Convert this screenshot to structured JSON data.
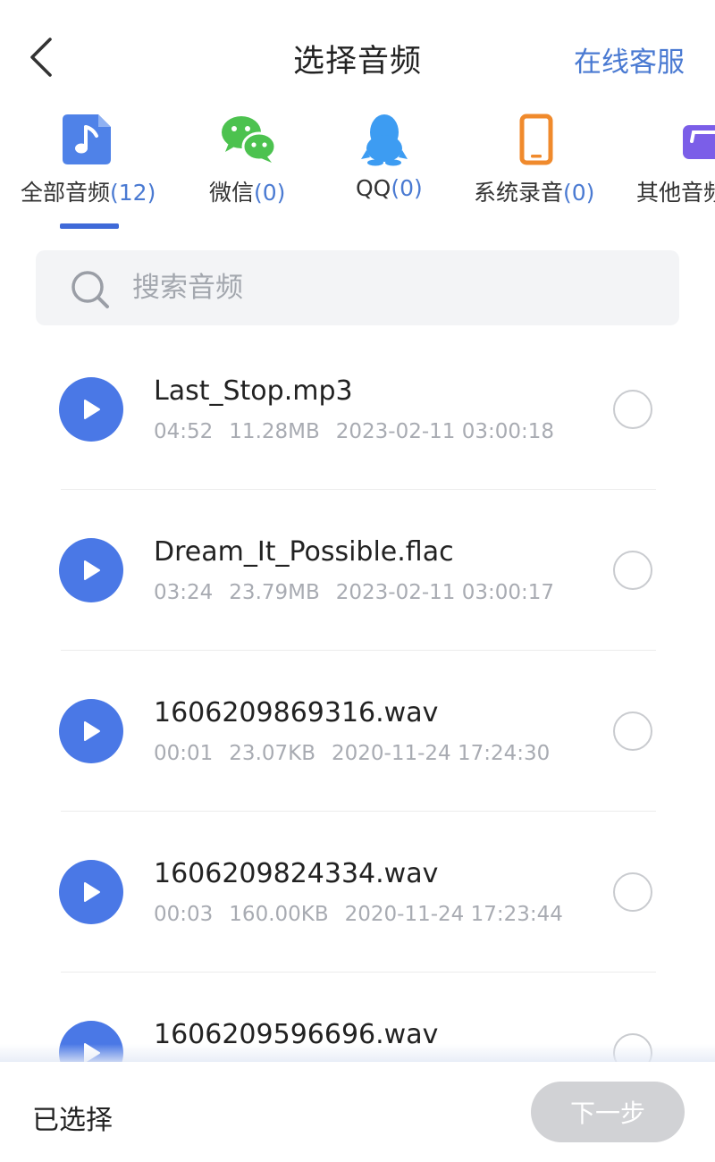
{
  "header": {
    "back_icon": "chevron-left-icon",
    "title": "选择音频",
    "service_label": "在线客服"
  },
  "tabs": [
    {
      "label": "全部音频",
      "count": "(12)",
      "icon": "music-note-icon",
      "color": "#4a7ad2",
      "active": true
    },
    {
      "label": "微信",
      "count": "(0)",
      "icon": "wechat-icon",
      "color": "#49c44b"
    },
    {
      "label": "QQ",
      "count": "(0)",
      "icon": "qq-penguin-icon",
      "color": "#3b9cf0"
    },
    {
      "label": "系统录音",
      "count": "(0)",
      "icon": "phone-icon",
      "color": "#f08a2c"
    },
    {
      "label": "其他音频",
      "count": "",
      "icon": "folder-icon",
      "color": "#7b5ee8"
    }
  ],
  "search": {
    "icon": "search-icon",
    "placeholder": "搜索音频"
  },
  "files": [
    {
      "name": "Last_Stop.mp3",
      "duration": "04:52",
      "size": "11.28MB",
      "date": "2023-02-11 03:00:18"
    },
    {
      "name": "Dream_It_Possible.flac",
      "duration": "03:24",
      "size": "23.79MB",
      "date": "2023-02-11 03:00:17"
    },
    {
      "name": "1606209869316.wav",
      "duration": "00:01",
      "size": "23.07KB",
      "date": "2020-11-24 17:24:30"
    },
    {
      "name": "1606209824334.wav",
      "duration": "00:03",
      "size": "160.00KB",
      "date": "2020-11-24 17:23:44"
    },
    {
      "name": "1606209596696.wav",
      "duration": "",
      "size": "",
      "date": ""
    }
  ],
  "bottom": {
    "selected_label": "已选择",
    "next_label": "下一步"
  },
  "colors": {
    "accent": "#4a78e6",
    "link": "#4a7ad2",
    "disabled_button": "#d1d2d5"
  }
}
